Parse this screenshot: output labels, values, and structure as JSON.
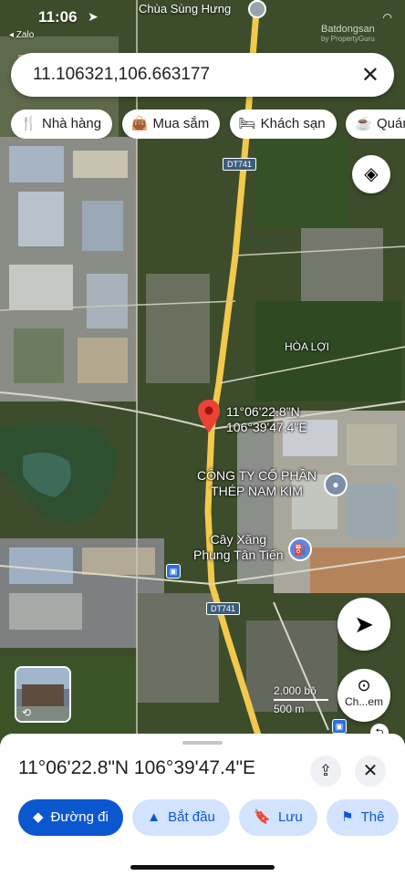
{
  "status_bar": {
    "time": "11:06",
    "back_app": "◂ Zalo"
  },
  "watermark": {
    "brand": "Batdongsan",
    "sub": "by PropertyGuru"
  },
  "search": {
    "query": "11.106321,106.663177"
  },
  "chips": [
    {
      "label": "Nhà hàng",
      "icon": "utensils-icon"
    },
    {
      "label": "Mua sắm",
      "icon": "shopping-bag-icon"
    },
    {
      "label": "Khách sạn",
      "icon": "bed-icon"
    },
    {
      "label": "Quán",
      "icon": "cup-icon"
    }
  ],
  "map": {
    "top_poi": "Chùa Sùng Hưng",
    "road_label_top": "DT741",
    "road_label_bottom": "DT741",
    "area_label": "HÒA LỢI",
    "pin_coord_line1": "11°06'22.8\"N",
    "pin_coord_line2": "106°39'47.4\"E",
    "company_line1": "CÔNG TY CỔ PHẦN",
    "company_line2": "THÉP NAM KIM",
    "gas_line1": "Cây Xăng",
    "gas_line2": "Phụng Tân Tiến",
    "scale_ft": "2.000 bộ",
    "scale_m": "500 m",
    "lens_label": "Ch...em"
  },
  "sheet": {
    "title": "11°06'22.8\"N 106°39'47.4\"E",
    "actions": [
      {
        "label": "Đường đi",
        "icon": "directions-icon",
        "primary": true
      },
      {
        "label": "Bắt đầu",
        "icon": "navigation-icon",
        "primary": false
      },
      {
        "label": "Lưu",
        "icon": "bookmark-icon",
        "primary": false
      },
      {
        "label": "Thê",
        "icon": "flag-icon",
        "primary": false
      }
    ]
  },
  "colors": {
    "accent": "#0b57d0",
    "pin": "#ea4335",
    "road": "#f2c94c"
  }
}
